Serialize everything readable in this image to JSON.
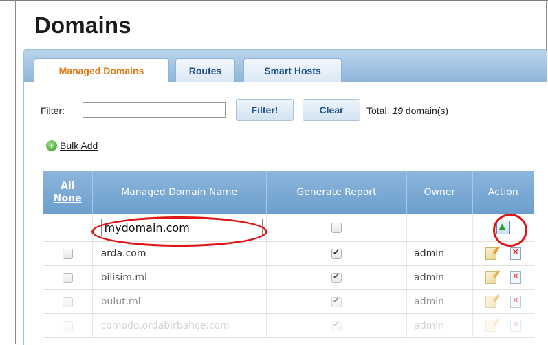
{
  "page": {
    "title": "Domains"
  },
  "tabs": [
    {
      "label": "Managed Domains",
      "active": true
    },
    {
      "label": "Routes",
      "active": false
    },
    {
      "label": "Smart Hosts",
      "active": false
    }
  ],
  "filter": {
    "label": "Filter:",
    "value": "",
    "filter_button": "Filter!",
    "clear_button": "Clear",
    "total_prefix": "Total:",
    "total_count": "19",
    "total_suffix": "domain(s)"
  },
  "bulk_add": {
    "label": "Bulk Add",
    "icon": "plus-circle-icon"
  },
  "table": {
    "select_all": "All",
    "select_none": "None",
    "headers": [
      "Managed Domain Name",
      "Generate Report",
      "Owner",
      "Action"
    ],
    "new_row": {
      "domain_value": "mydomain.com",
      "generate_report": false
    },
    "rows": [
      {
        "domain": "arda.com",
        "generate_report": true,
        "owner": "admin"
      },
      {
        "domain": "bilisim.ml",
        "generate_report": true,
        "owner": "admin"
      },
      {
        "domain": "bulut.ml",
        "generate_report": true,
        "owner": "admin"
      },
      {
        "domain": "comodo.ordabirbahce.com",
        "generate_report": true,
        "owner": "admin"
      }
    ]
  },
  "colors": {
    "accent_tab": "#e07a17",
    "header_blue": "#6c9ecd",
    "annotation_red": "#e01515"
  }
}
